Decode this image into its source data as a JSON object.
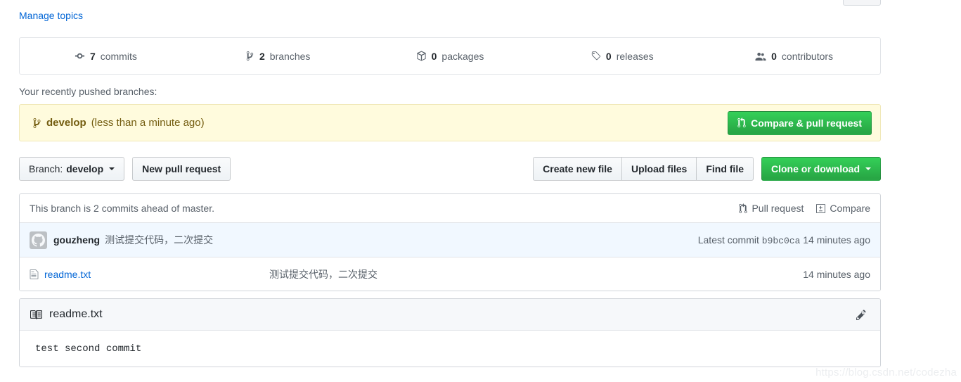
{
  "manage_topics": {
    "label": "Manage topics"
  },
  "stats": {
    "items": [
      {
        "icon": "commit-icon",
        "count": "7",
        "label": "commits",
        "name": "stat-commits"
      },
      {
        "icon": "branch-icon",
        "count": "2",
        "label": "branches",
        "name": "stat-branches"
      },
      {
        "icon": "package-icon",
        "count": "0",
        "label": "packages",
        "name": "stat-packages"
      },
      {
        "icon": "tag-icon",
        "count": "0",
        "label": "releases",
        "name": "stat-releases"
      },
      {
        "icon": "people-icon",
        "count": "0",
        "label": "contributors",
        "name": "stat-contributors"
      }
    ]
  },
  "pushed": {
    "label": "Your recently pushed branches:",
    "branch_name": "develop",
    "time": "(less than a minute ago)",
    "compare_pr_label": "Compare & pull request",
    "branch_icon": "git-branch-icon",
    "pr_icon": "git-pull-request-icon"
  },
  "toolbar": {
    "branch_prefix": "Branch:",
    "branch_value": "develop",
    "new_pull_request": "New pull request",
    "create_new_file": "Create new file",
    "upload_files": "Upload files",
    "find_file": "Find file",
    "clone_or_download": "Clone or download"
  },
  "branch_status": {
    "text": "This branch is 2 commits ahead of master.",
    "pull_request": "Pull request",
    "compare": "Compare"
  },
  "commit": {
    "author": "gouzheng",
    "message": "测试提交代码，二次提交",
    "latest_label": "Latest commit",
    "sha": "b9bc0ca",
    "time": "14 minutes ago"
  },
  "files": [
    {
      "name": "readme.txt",
      "commit_message": "测试提交代码，二次提交",
      "time": "14 minutes ago",
      "icon": "file-text-icon"
    }
  ],
  "readme": {
    "title": "readme.txt",
    "icon": "book-icon",
    "edit_icon": "pencil-icon",
    "content": "test second commit"
  },
  "watermark": {
    "text": "https://blog.csdn.net/codezha"
  },
  "colors": {
    "link": "#0366d6",
    "green": "#28a745",
    "notice_bg": "#fffbdd",
    "notice_text": "#735c0f",
    "commit_row_bg": "#f1f8ff",
    "muted": "#586069",
    "border": "#e1e4e8"
  }
}
